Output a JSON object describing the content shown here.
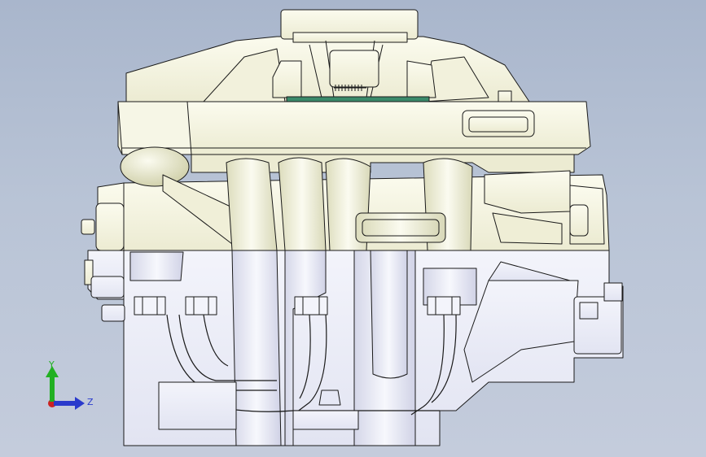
{
  "viewport": {
    "model_name": "cad-assembly-front-view",
    "colors": {
      "background_top": "#a9b6cc",
      "background_bottom": "#c4ccdc",
      "part_upper": "#f4f4e2",
      "part_lower": "#eceef8",
      "edge": "#1a1a1a",
      "shadow": "#cfcfae",
      "accent_green": "#3a8a6a"
    }
  },
  "triad": {
    "y_label": "Y",
    "z_label": "Z",
    "colors": {
      "y": "#22b022",
      "z": "#2a3acc",
      "x": "#cc2222"
    }
  }
}
